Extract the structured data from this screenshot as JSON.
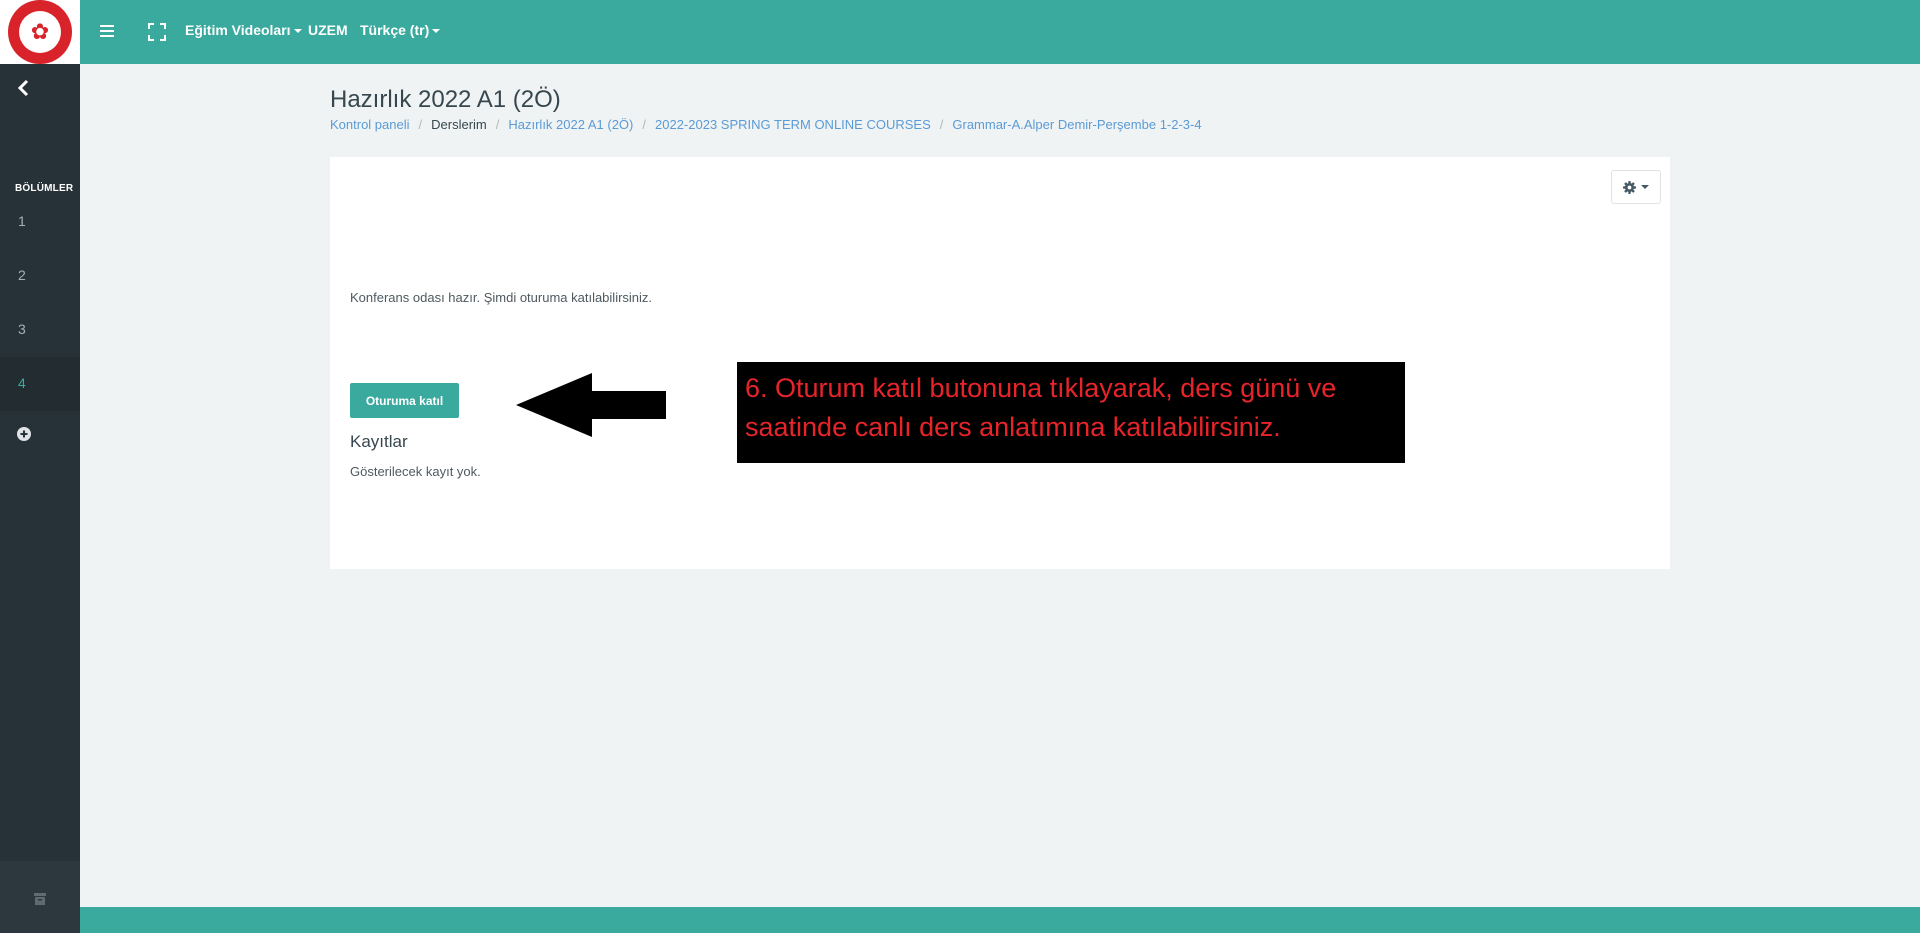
{
  "navbar": {
    "menu_links": [
      {
        "label": "Eğitim Videoları",
        "has_dropdown": true
      },
      {
        "label": "UZEM",
        "has_dropdown": false
      },
      {
        "label": "Türkçe (tr)",
        "has_dropdown": true
      }
    ],
    "icons": [
      "logo",
      "hamburger-icon",
      "fullscreen-icon"
    ]
  },
  "sidebar": {
    "heading": "BÖLÜMLER",
    "items": [
      {
        "label": "1",
        "active": false
      },
      {
        "label": "2",
        "active": false
      },
      {
        "label": "3",
        "active": false
      },
      {
        "label": "4",
        "active": true
      }
    ],
    "icons": [
      "back-chevron-icon",
      "add-section-icon",
      "block-icon"
    ]
  },
  "page": {
    "title": "Hazırlık 2022 A1 (2Ö)",
    "breadcrumb": [
      {
        "label": "Kontrol paneli",
        "link": true
      },
      {
        "label": "Derslerim",
        "link": false
      },
      {
        "label": "Hazırlık 2022 A1 (2Ö)",
        "link": true
      },
      {
        "label": "2022-2023 SPRING TERM ONLINE COURSES",
        "link": true
      },
      {
        "label": "Grammar-A.Alper Demir-Perşembe 1-2-3-4",
        "link": true
      }
    ]
  },
  "card": {
    "status_text": "Konferans odası hazır. Şimdi oturuma katılabilirsiniz.",
    "join_button_label": "Oturuma katıl",
    "recordings_heading": "Kayıtlar",
    "recordings_empty": "Gösterilecek kayıt yok."
  },
  "annotation": {
    "text": "6. Oturum katıl butonuna tıklayarak, ders günü ve saatinde canlı ders anlatımına katılabilirsiniz."
  },
  "colors": {
    "brand": "#3aaa9f",
    "sidebar": "#263238",
    "annotation_text": "#e8242b",
    "link": "#5b9bd5"
  }
}
